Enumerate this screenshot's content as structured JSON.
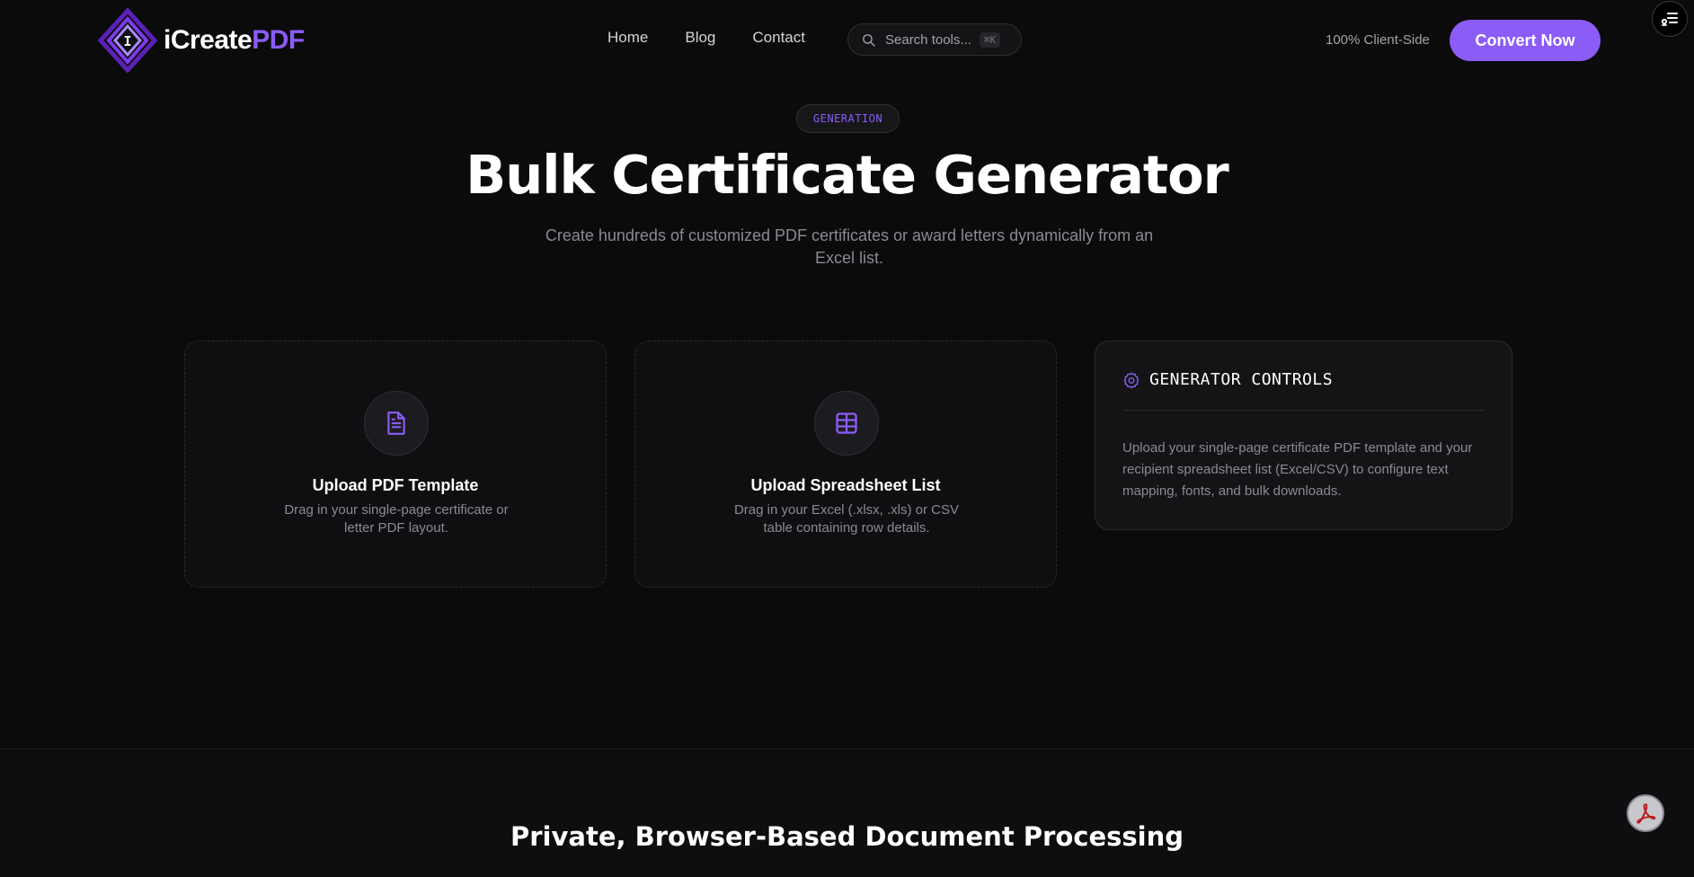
{
  "header": {
    "logo": {
      "icon": "diamond-logo-icon",
      "mark_letter": "I",
      "name_prefix": "iCreate",
      "name_accent": "PDF"
    },
    "nav": [
      "Home",
      "Blog",
      "Contact"
    ],
    "search": {
      "placeholder": "Search tools...",
      "shortcut": "⌘K"
    },
    "client_side_label": "100% Client-Side",
    "convert_label": "Convert Now",
    "menu_icon": "filter-menu-icon"
  },
  "hero": {
    "badge": "GENERATION",
    "title": "Bulk Certificate Generator",
    "subtitle": "Create hundreds of customized PDF certificates or award letters dynamically from an Excel list."
  },
  "cards": {
    "pdf_upload": {
      "icon": "document-icon",
      "title": "Upload PDF Template",
      "description": "Drag in your single-page certificate or letter PDF layout."
    },
    "sheet_upload": {
      "icon": "table-icon",
      "title": "Upload Spreadsheet List",
      "description": "Drag in your Excel (.xlsx, .xls) or CSV table containing row details."
    },
    "controls": {
      "icon": "gear-icon",
      "title": "GENERATOR CONTROLS",
      "text": "Upload your single-page certificate PDF template and your recipient spreadsheet list (Excel/CSV) to configure text mapping, fonts, and bulk downloads."
    }
  },
  "lower_section": {
    "title": "Private, Browser-Based Document Processing"
  },
  "floating_button_icon": "acrobat-pdf-icon",
  "colors": {
    "accent": "#8b5cf6",
    "background": "#0b0b0c",
    "muted_text": "#8a8a93"
  }
}
